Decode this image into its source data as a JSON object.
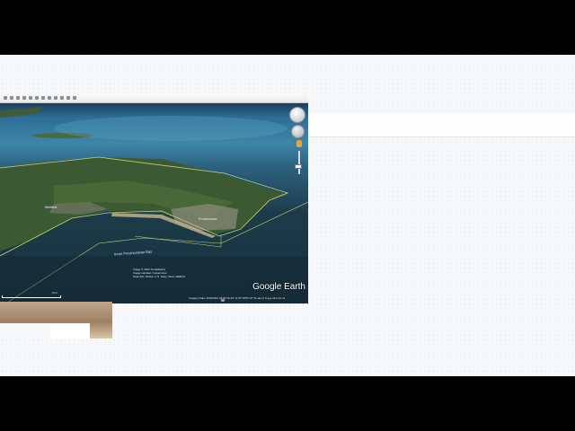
{
  "google_earth": {
    "logo": "Google Earth",
    "labels": {
      "bay": "Inner Provincetown Bay",
      "town_left": "Wellfleet",
      "town_right": "Provincetown"
    },
    "attribution": {
      "line1": "Image © 2022 TerraMetrics",
      "line2": "Image Landsat / Copernicus",
      "line3": "Data SIO, NOAA, U.S. Navy, NGA, GEBCO"
    },
    "status": "Imagery Date: 9/30/2021    42°02'16.43\" N  70°10'55.72\" W   elev  0 ft   eye alt  2.21 mi",
    "scale_label": "2 mi"
  },
  "icons": [
    "compass-icon",
    "look-control-icon",
    "pegman-icon",
    "zoom-slider-icon"
  ],
  "colors": {
    "water": "#1d3b4a",
    "land": "#3b5a33",
    "boundary": "#c8d27a"
  }
}
